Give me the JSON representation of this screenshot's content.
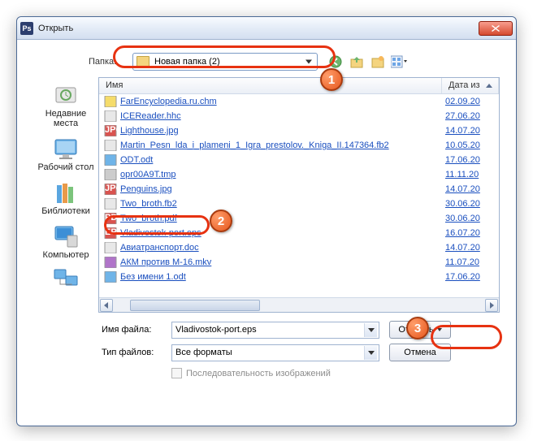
{
  "titlebar": {
    "app_icon_text": "Ps",
    "title": "Открыть"
  },
  "folder_row": {
    "label": "Папка:",
    "value": "Новая папка (2)"
  },
  "nav": {
    "back": "back-icon",
    "up": "up-icon",
    "newfolder": "new-folder-icon",
    "view": "view-icon"
  },
  "columns": {
    "name": "Имя",
    "date": "Дата из"
  },
  "places": [
    {
      "label": "Недавние места"
    },
    {
      "label": "Рабочий стол"
    },
    {
      "label": "Библиотеки"
    },
    {
      "label": "Компьютер"
    },
    {
      "label": ""
    }
  ],
  "files": [
    {
      "name": "FarEncyclopedia.ru.chm",
      "date": "02.09.20",
      "ico": "chm"
    },
    {
      "name": "ICEReader.hhc",
      "date": "27.06.20",
      "ico": "doc"
    },
    {
      "name": "Lighthouse.jpg",
      "date": "14.07.20",
      "ico": "jpg"
    },
    {
      "name": "Martin_Pesn_lda_i_plameni_1_Igra_prestolov._Kniga_II.147364.fb2",
      "date": "10.05.20",
      "ico": "doc"
    },
    {
      "name": "ODT.odt",
      "date": "17.06.20",
      "ico": "odt"
    },
    {
      "name": "opr00A9T.tmp",
      "date": "11.11.20",
      "ico": "tmp"
    },
    {
      "name": "Penguins.jpg",
      "date": "14.07.20",
      "ico": "jpg"
    },
    {
      "name": "Two_broth.fb2",
      "date": "30.06.20",
      "ico": "doc"
    },
    {
      "name": "Two_broth.pdf",
      "date": "30.06.20",
      "ico": "pdf",
      "cut": true
    },
    {
      "name": "Vladivostok-port.eps",
      "date": "16.07.20",
      "ico": "eps",
      "sel": true
    },
    {
      "name": "Авиатранспорт.doc",
      "date": "14.07.20",
      "ico": "doc"
    },
    {
      "name": "АКМ против М-16.mkv",
      "date": "11.07.20",
      "ico": "mkv"
    },
    {
      "name": "Без имени 1.odt",
      "date": "17.06.20",
      "ico": "odt"
    }
  ],
  "filename": {
    "label": "Имя файла:",
    "value": "Vladivostok-port.eps"
  },
  "filetype": {
    "label": "Тип файлов:",
    "value": "Все форматы"
  },
  "buttons": {
    "open": "Открыть",
    "cancel": "Отмена"
  },
  "checkbox": {
    "label": "Последовательность изображений"
  },
  "badges": {
    "1": "1",
    "2": "2",
    "3": "3"
  }
}
